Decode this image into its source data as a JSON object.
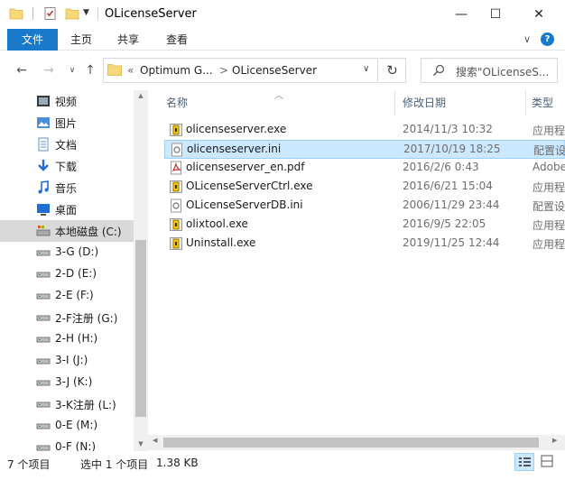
{
  "window": {
    "title": "OLicenseServer",
    "minimize_glyph": "—",
    "maximize_glyph": "☐",
    "close_glyph": "✕"
  },
  "ribbon": {
    "tabs": [
      {
        "label": "文件"
      },
      {
        "label": "主页"
      },
      {
        "label": "共享"
      },
      {
        "label": "查看"
      }
    ],
    "expand_glyph": "∨",
    "help_glyph": "?"
  },
  "address": {
    "prefix": "«",
    "segments": [
      "Optimum G...",
      "OLicenseServer"
    ],
    "separator": ">",
    "dropdown_glyph": "∨",
    "refresh_glyph": "↻"
  },
  "search": {
    "placeholder": "搜索\"OLicenseS..."
  },
  "nav_buttons": {
    "back": "←",
    "forward": "→",
    "recent": "∨",
    "up": "↑"
  },
  "navpane": {
    "items": [
      {
        "label": "视频",
        "icon": "video-icon"
      },
      {
        "label": "图片",
        "icon": "pictures-icon"
      },
      {
        "label": "文档",
        "icon": "documents-icon"
      },
      {
        "label": "下载",
        "icon": "downloads-icon"
      },
      {
        "label": "音乐",
        "icon": "music-icon"
      },
      {
        "label": "桌面",
        "icon": "desktop-icon"
      },
      {
        "label": "本地磁盘 (C:)",
        "icon": "local-disk-icon"
      },
      {
        "label": "3-G (D:)",
        "icon": "drive-icon"
      },
      {
        "label": "2-D (E:)",
        "icon": "drive-icon"
      },
      {
        "label": "2-E (F:)",
        "icon": "drive-icon"
      },
      {
        "label": "2-F注册 (G:)",
        "icon": "drive-icon"
      },
      {
        "label": "2-H (H:)",
        "icon": "drive-icon"
      },
      {
        "label": "3-I (J:)",
        "icon": "drive-icon"
      },
      {
        "label": "3-J (K:)",
        "icon": "drive-icon"
      },
      {
        "label": "3-K注册 (L:)",
        "icon": "drive-icon"
      },
      {
        "label": "0-E (M:)",
        "icon": "drive-icon"
      },
      {
        "label": "0-F (N:)",
        "icon": "drive-icon"
      }
    ],
    "selected_index": 6
  },
  "columns": {
    "name": "名称",
    "date": "修改日期",
    "type": "类型"
  },
  "files": [
    {
      "name": "olicenseserver.exe",
      "date": "2014/11/3 10:32",
      "type": "应用程序",
      "icon": "exe-icon",
      "selected": false
    },
    {
      "name": "olicenseserver.ini",
      "date": "2017/10/19 18:25",
      "type": "配置设置",
      "icon": "ini-icon",
      "selected": true
    },
    {
      "name": "olicenseserver_en.pdf",
      "date": "2016/2/6 0:43",
      "type": "Adobe",
      "icon": "pdf-icon",
      "selected": false
    },
    {
      "name": "OLicenseServerCtrl.exe",
      "date": "2016/6/21 15:04",
      "type": "应用程序",
      "icon": "exe-icon",
      "selected": false
    },
    {
      "name": "OLicenseServerDB.ini",
      "date": "2006/11/29 23:44",
      "type": "配置设置",
      "icon": "ini-icon",
      "selected": false
    },
    {
      "name": "olixtool.exe",
      "date": "2016/9/5 22:05",
      "type": "应用程序",
      "icon": "exe-icon",
      "selected": false
    },
    {
      "name": "Uninstall.exe",
      "date": "2019/11/25 12:44",
      "type": "应用程序",
      "icon": "exe-icon",
      "selected": false
    }
  ],
  "status": {
    "count": "7 个项目",
    "selected": "选中 1 个项目",
    "size": "1.38 KB"
  },
  "colors": {
    "accent": "#1979ca",
    "selection_bg": "#cce8ff",
    "selection_border": "#99d1ff",
    "folder": "#f8d775"
  }
}
